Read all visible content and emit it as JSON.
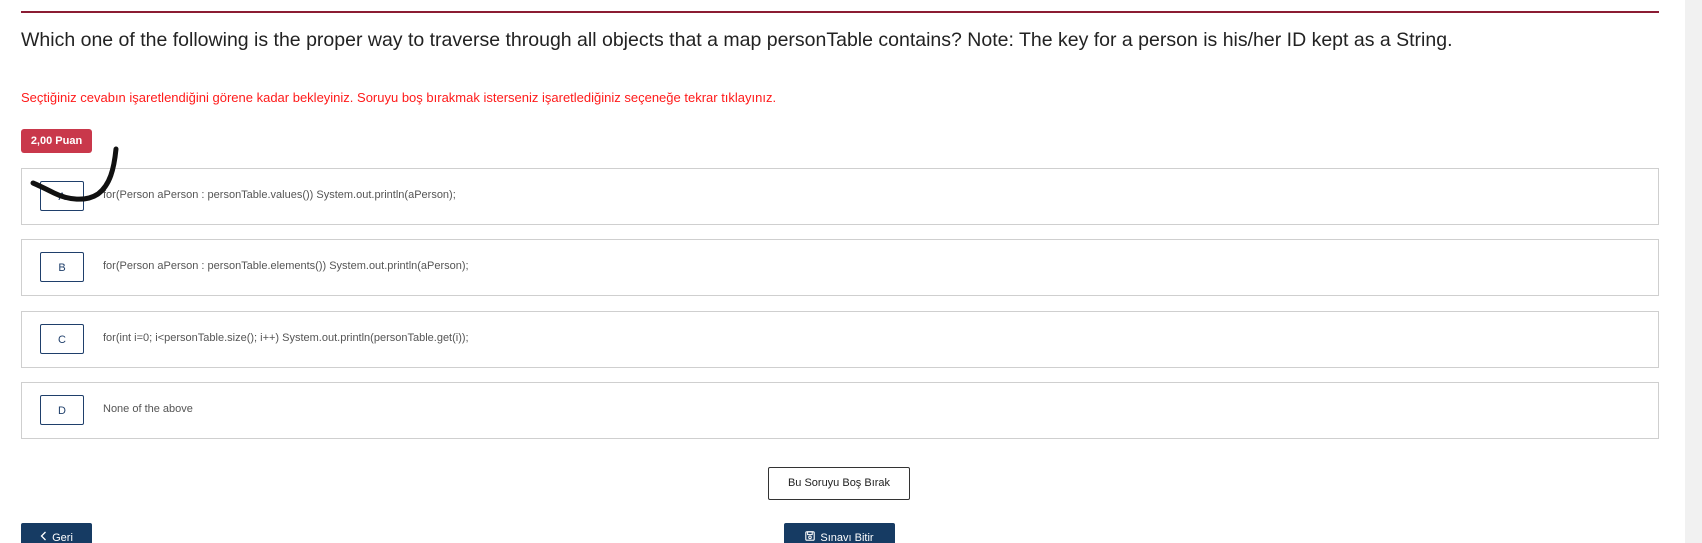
{
  "question": {
    "text": "Which one of the following is the proper way to traverse through all objects that a map personTable contains? Note: The key for a person is his/her ID kept as a String.",
    "warning": "Seçtiğiniz cevabın işaretlendiğini görene kadar bekleyiniz. Soruyu boş bırakmak isterseniz işaretlediğiniz seçeneğe tekrar tıklayınız.",
    "points_badge": "2,00 Puan"
  },
  "options": [
    {
      "letter": "A",
      "text": "for(Person aPerson : personTable.values()) System.out.println(aPerson);"
    },
    {
      "letter": "B",
      "text": "for(Person aPerson : personTable.elements()) System.out.println(aPerson);"
    },
    {
      "letter": "C",
      "text": "for(int i=0; i<personTable.size(); i++) System.out.println(personTable.get(i));"
    },
    {
      "letter": "D",
      "text": "None of the above"
    }
  ],
  "actions": {
    "skip_label": "Bu Soruyu Boş Bırak",
    "back_label": "Geri",
    "back_icon": "chevron-left-icon",
    "finish_label": "Sınavı Bitir",
    "finish_icon": "save-icon"
  },
  "colors": {
    "accent_rule": "#8b1c33",
    "warning": "#ff1a1a",
    "badge": "#c9384b",
    "primary_button": "#163b63"
  }
}
